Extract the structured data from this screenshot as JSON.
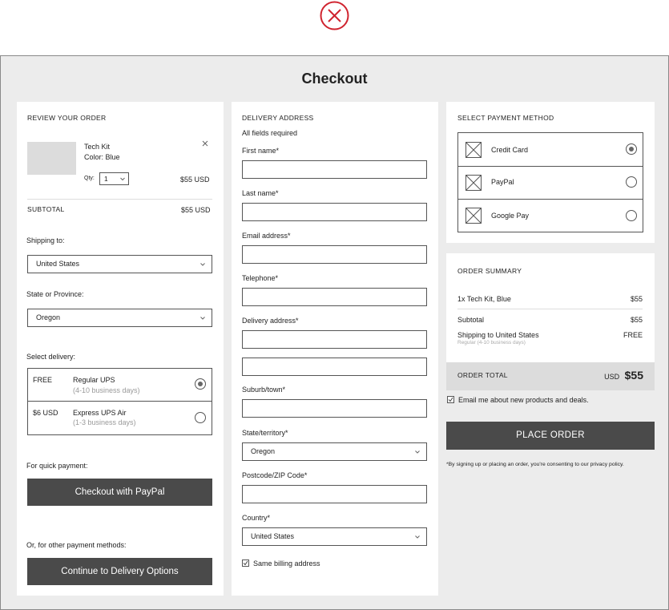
{
  "page": {
    "title": "Checkout"
  },
  "review": {
    "heading": "REVIEW YOUR ORDER",
    "item": {
      "name": "Tech Kit",
      "color": "Color: Blue",
      "qty_label": "Qty:",
      "qty": "1",
      "price": "$55 USD"
    },
    "subtotal_label": "SUBTOTAL",
    "subtotal_value": "$55 USD",
    "shipping_label": "Shipping to:",
    "shipping_value": "United States",
    "state_label": "State or Province:",
    "state_value": "Oregon",
    "delivery_label": "Select delivery:",
    "delivery_options": [
      {
        "price": "FREE",
        "name": "Regular UPS",
        "days": "(4-10 business days)",
        "selected": true
      },
      {
        "price": "$6 USD",
        "name": "Express UPS Air",
        "days": "(1-3 business days)",
        "selected": false
      }
    ],
    "quick_label": "For quick payment:",
    "paypal_button": "Checkout with PayPal",
    "other_label": "Or, for other payment methods:",
    "continue_button": "Continue to Delivery Options"
  },
  "delivery": {
    "heading": "DELIVERY ADDRESS",
    "required_note": "All fields required",
    "first_name": "First name*",
    "last_name": "Last name*",
    "email": "Email address*",
    "telephone": "Telephone*",
    "address": "Delivery address*",
    "suburb": "Suburb/town*",
    "state_label": "State/territory*",
    "state_value": "Oregon",
    "postcode": "Postcode/ZIP Code*",
    "country_label": "Country*",
    "country_value": "United States",
    "same_billing": "Same billing address",
    "same_billing_checked": true
  },
  "payment": {
    "heading": "SELECT PAYMENT METHOD",
    "methods": [
      {
        "label": "Credit Card",
        "selected": true
      },
      {
        "label": "PayPal",
        "selected": false
      },
      {
        "label": "Google Pay",
        "selected": false
      }
    ]
  },
  "summary": {
    "heading": "ORDER SUMMARY",
    "item_label": "1x Tech Kit, Blue",
    "item_value": "$55",
    "subtotal_label": "Subtotal",
    "subtotal_value": "$55",
    "shipping_label": "Shipping to United States",
    "shipping_value": "FREE",
    "shipping_note": "Regular (4-10 business days)",
    "total_label": "ORDER TOTAL",
    "total_currency": "USD",
    "total_value": "$55",
    "email_opt": "Email me about new products and deals.",
    "email_opt_checked": true,
    "place_order": "PLACE ORDER",
    "disclaimer": "*By signing up or placing an order, you're consenting to our privacy policy."
  },
  "colors": {
    "close": "#d0242f",
    "button": "#4a4a4a",
    "background": "#ececec"
  }
}
